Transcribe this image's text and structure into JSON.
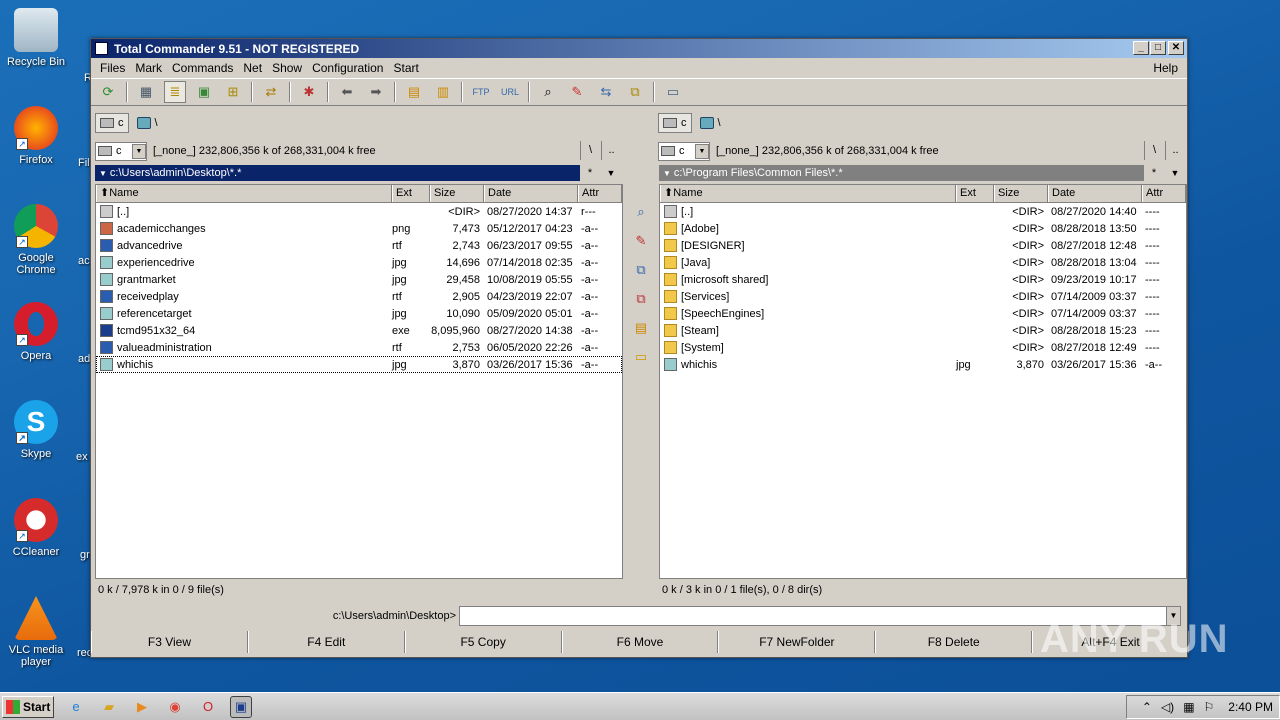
{
  "desktop": {
    "icons": [
      {
        "label": "Recycle Bin"
      },
      {
        "label": "Firefox"
      },
      {
        "label": "Google Chrome"
      },
      {
        "label": "Opera"
      },
      {
        "label": "Skype"
      },
      {
        "label": "CCleaner"
      },
      {
        "label": "VLC media player"
      }
    ],
    "partial_labels": [
      "R",
      "Fil",
      "ac",
      "ad",
      "ex",
      "gr",
      "rec"
    ]
  },
  "window": {
    "title": "Total Commander 9.51 - NOT REGISTERED",
    "menu": [
      "Files",
      "Mark",
      "Commands",
      "Net",
      "Show",
      "Configuration",
      "Start"
    ],
    "menu_help": "Help",
    "toolbar_icons": [
      "refresh-icon",
      "brief-view-icon",
      "detailed-view-icon",
      "thumbnail-view-icon",
      "tree-view-icon",
      "invert-selection-icon",
      "reread-icon",
      "back-icon",
      "forward-icon",
      "pack-icon",
      "unpack-icon",
      "ftp-connect-icon",
      "url-connect-icon",
      "find-files-icon",
      "multi-rename-icon",
      "sync-dirs-icon",
      "compare-icon",
      "notepad-icon"
    ],
    "left": {
      "drive": "c",
      "net_path": "\\",
      "drive_combo": "c",
      "free_info": "[_none_]  232,806,356 k of 268,331,004 k free",
      "root_btn": "\\",
      "up_btn": "..",
      "path": "c:\\Users\\admin\\Desktop\\*.*",
      "star": "*",
      "columns": {
        "name": "Name",
        "ext": "Ext",
        "size": "Size",
        "date": "Date",
        "attr": "Attr"
      },
      "files": [
        {
          "name": "[..]",
          "ext": "",
          "size": "<DIR>",
          "date": "08/27/2020 14:37",
          "attr": "r---",
          "icon": "up"
        },
        {
          "name": "academicchanges",
          "ext": "png",
          "size": "7,473",
          "date": "05/12/2017 04:23",
          "attr": "-a--",
          "icon": "png"
        },
        {
          "name": "advancedrive",
          "ext": "rtf",
          "size": "2,743",
          "date": "06/23/2017 09:55",
          "attr": "-a--",
          "icon": "rtf"
        },
        {
          "name": "experiencedrive",
          "ext": "jpg",
          "size": "14,696",
          "date": "07/14/2018 02:35",
          "attr": "-a--",
          "icon": "jpg"
        },
        {
          "name": "grantmarket",
          "ext": "jpg",
          "size": "29,458",
          "date": "10/08/2019 05:55",
          "attr": "-a--",
          "icon": "jpg"
        },
        {
          "name": "receivedplay",
          "ext": "rtf",
          "size": "2,905",
          "date": "04/23/2019 22:07",
          "attr": "-a--",
          "icon": "rtf"
        },
        {
          "name": "referencetarget",
          "ext": "jpg",
          "size": "10,090",
          "date": "05/09/2020 05:01",
          "attr": "-a--",
          "icon": "jpg"
        },
        {
          "name": "tcmd951x32_64",
          "ext": "exe",
          "size": "8,095,960",
          "date": "08/27/2020 14:38",
          "attr": "-a--",
          "icon": "exe"
        },
        {
          "name": "valueadministration",
          "ext": "rtf",
          "size": "2,753",
          "date": "06/05/2020 22:26",
          "attr": "-a--",
          "icon": "rtf"
        },
        {
          "name": "whichis",
          "ext": "jpg",
          "size": "3,870",
          "date": "03/26/2017 15:36",
          "attr": "-a--",
          "icon": "jpg"
        }
      ],
      "status": "0 k / 7,978 k in 0 / 9 file(s)"
    },
    "right": {
      "drive": "c",
      "net_path": "\\",
      "drive_combo": "c",
      "free_info": "[_none_]  232,806,356 k of 268,331,004 k free",
      "root_btn": "\\",
      "up_btn": "..",
      "path": "c:\\Program Files\\Common Files\\*.*",
      "star": "*",
      "columns": {
        "name": "Name",
        "ext": "Ext",
        "size": "Size",
        "date": "Date",
        "attr": "Attr"
      },
      "files": [
        {
          "name": "[..]",
          "ext": "",
          "size": "<DIR>",
          "date": "08/27/2020 14:40",
          "attr": "----",
          "icon": "up"
        },
        {
          "name": "[Adobe]",
          "ext": "",
          "size": "<DIR>",
          "date": "08/28/2018 13:50",
          "attr": "----",
          "icon": "folder"
        },
        {
          "name": "[DESIGNER]",
          "ext": "",
          "size": "<DIR>",
          "date": "08/27/2018 12:48",
          "attr": "----",
          "icon": "folder"
        },
        {
          "name": "[Java]",
          "ext": "",
          "size": "<DIR>",
          "date": "08/28/2018 13:04",
          "attr": "----",
          "icon": "folder"
        },
        {
          "name": "[microsoft shared]",
          "ext": "",
          "size": "<DIR>",
          "date": "09/23/2019 10:17",
          "attr": "----",
          "icon": "folder"
        },
        {
          "name": "[Services]",
          "ext": "",
          "size": "<DIR>",
          "date": "07/14/2009 03:37",
          "attr": "----",
          "icon": "folder"
        },
        {
          "name": "[SpeechEngines]",
          "ext": "",
          "size": "<DIR>",
          "date": "07/14/2009 03:37",
          "attr": "----",
          "icon": "folder"
        },
        {
          "name": "[Steam]",
          "ext": "",
          "size": "<DIR>",
          "date": "08/28/2018 15:23",
          "attr": "----",
          "icon": "folder"
        },
        {
          "name": "[System]",
          "ext": "",
          "size": "<DIR>",
          "date": "08/27/2018 12:49",
          "attr": "----",
          "icon": "folder"
        },
        {
          "name": "whichis",
          "ext": "jpg",
          "size": "3,870",
          "date": "03/26/2017 15:36",
          "attr": "-a--",
          "icon": "jpg"
        }
      ],
      "status": "0 k / 3 k in 0 / 1 file(s), 0 / 8 dir(s)"
    },
    "cmd_label": "c:\\Users\\admin\\Desktop>",
    "cmd_value": "",
    "fkeys": [
      "F3 View",
      "F4 Edit",
      "F5 Copy",
      "F6 Move",
      "F7 NewFolder",
      "F8 Delete",
      "Alt+F4 Exit"
    ]
  },
  "watermark": "ANY RUN",
  "taskbar": {
    "start": "Start",
    "clock": "2:40 PM"
  }
}
